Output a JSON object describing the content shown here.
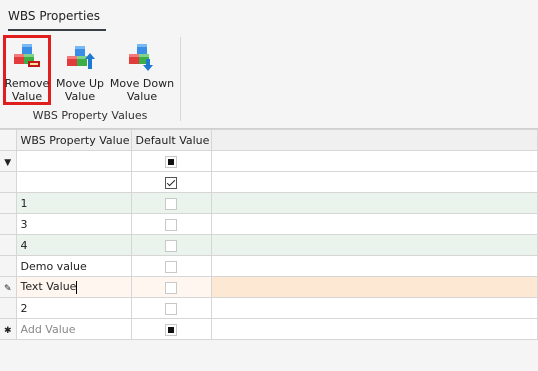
{
  "tab": {
    "title": "WBS Properties"
  },
  "ribbon": {
    "buttons": [
      {
        "line1": "Remove",
        "line2": "Value"
      },
      {
        "line1": "Move Up",
        "line2": "Value"
      },
      {
        "line1": "Move Down",
        "line2": "Value"
      }
    ],
    "group_caption": "WBS Property Values"
  },
  "grid": {
    "columns": [
      "WBS Property Value",
      "Default Value"
    ],
    "rows": [
      {
        "value": "",
        "default": "indeterminate"
      },
      {
        "value": "",
        "default": "checked"
      },
      {
        "value": "1",
        "default": "unchecked"
      },
      {
        "value": "3",
        "default": "unchecked"
      },
      {
        "value": "4",
        "default": "unchecked"
      },
      {
        "value": "Demo value",
        "default": "unchecked"
      },
      {
        "value": "Text Value",
        "default": "unchecked"
      },
      {
        "value": "2",
        "default": "unchecked"
      }
    ],
    "new_row_placeholder": "Add Value",
    "new_row_default": "indeterminate"
  },
  "colors": {
    "selection_outline": "#e01e1e",
    "alt_row": "#eaf3ec",
    "edit_row": "#fff7ef"
  },
  "icons": [
    "filter-icon",
    "pencil-icon",
    "asterisk-icon",
    "remove-value-icon",
    "move-up-icon",
    "move-down-icon"
  ]
}
